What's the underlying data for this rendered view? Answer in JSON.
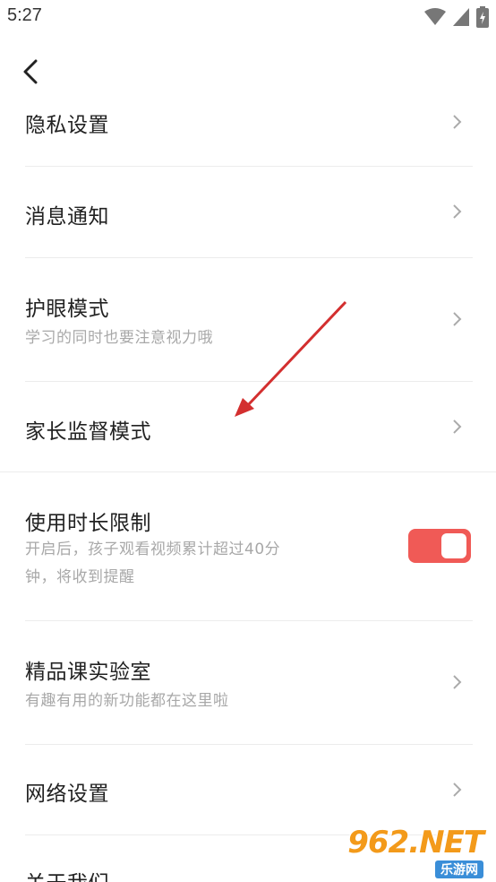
{
  "status_bar": {
    "time": "5:27"
  },
  "settings": {
    "privacy": {
      "title": "隐私设置"
    },
    "notifications": {
      "title": "消息通知"
    },
    "eye_care": {
      "title": "护眼模式",
      "subtitle": "学习的同时也要注意视力哦"
    },
    "parental": {
      "title": "家长监督模式"
    },
    "usage_limit": {
      "title": "使用时长限制",
      "subtitle_line1": "开启后，孩子观看视频累计超过40分",
      "subtitle_line2": "钟，将收到提醒",
      "enabled": true
    },
    "lab": {
      "title": "精品课实验室",
      "subtitle": "有趣有用的新功能都在这里啦"
    },
    "network": {
      "title": "网络设置"
    },
    "about": {
      "title": "关于我们"
    }
  },
  "watermark": {
    "top": "962.NET",
    "bottom": "乐游网"
  },
  "colors": {
    "accent": "#f05a56",
    "annotation_arrow": "#d32f2f",
    "divider": "#ececec"
  }
}
